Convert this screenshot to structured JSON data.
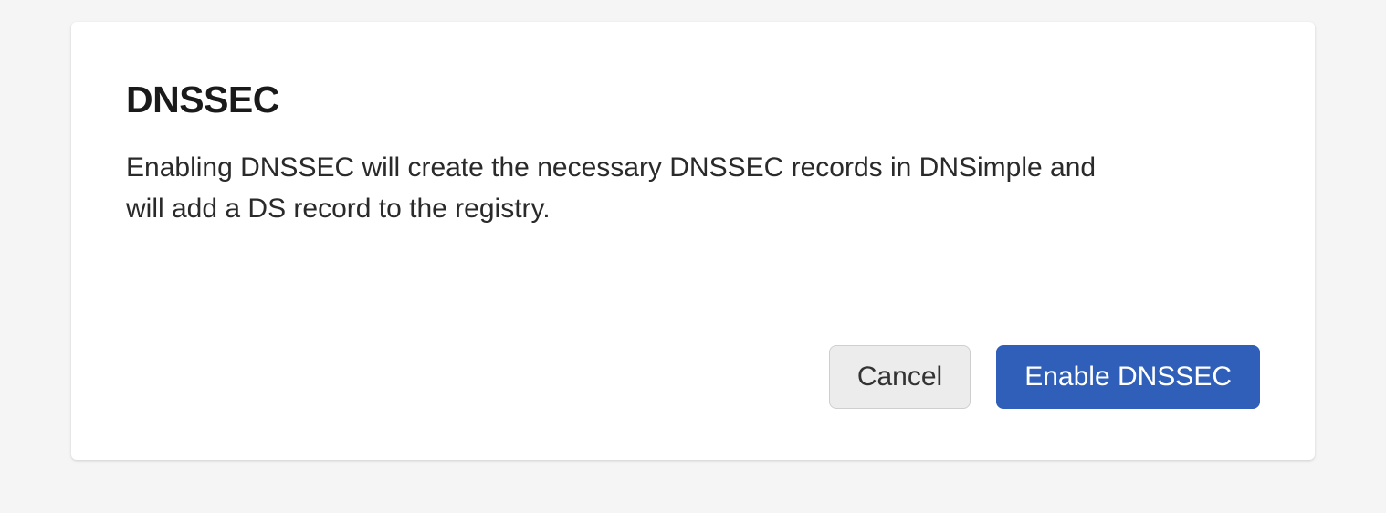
{
  "dialog": {
    "title": "DNSSEC",
    "description": "Enabling DNSSEC will create the necessary DNSSEC records in DNSimple and will add a DS record to the registry.",
    "cancel_label": "Cancel",
    "confirm_label": "Enable DNSSEC"
  }
}
